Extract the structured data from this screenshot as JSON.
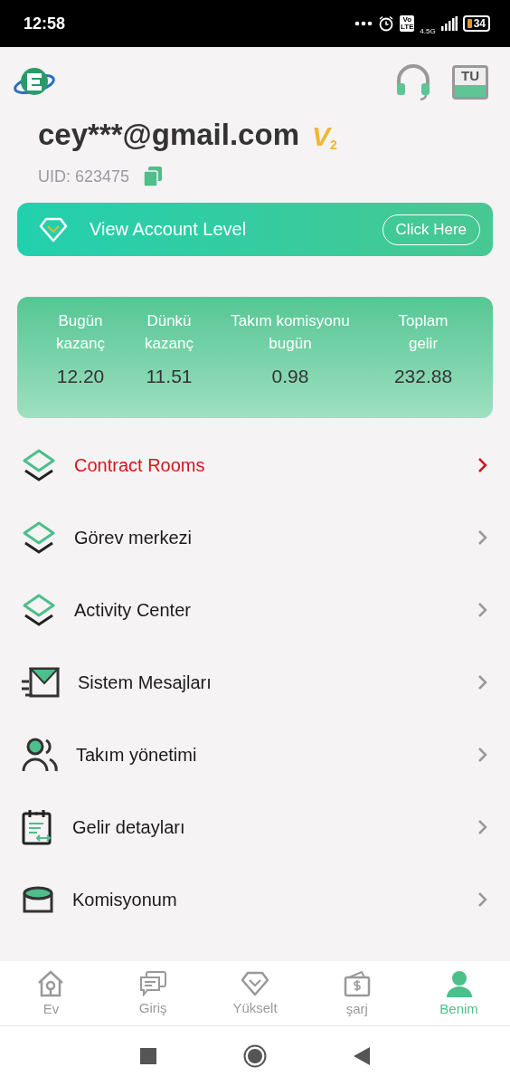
{
  "status_bar": {
    "time": "12:58",
    "network": "4.5G",
    "volte": "Vo LTE",
    "battery": "34"
  },
  "header": {
    "language": "TU"
  },
  "account": {
    "email": "cey***@gmail.com",
    "level_badge": "V",
    "level_number": "2",
    "uid": "UID: 623475"
  },
  "level_banner": {
    "label": "View Account Level",
    "button": "Click Here"
  },
  "stats": [
    {
      "label": "Bugün kazanç",
      "value": "12.20"
    },
    {
      "label": "Dünkü kazanç",
      "value": "11.51"
    },
    {
      "label": "Takım komisyonu bugün",
      "value": "0.98"
    },
    {
      "label": "Toplam gelir",
      "value": "232.88"
    }
  ],
  "menu": [
    {
      "kind": "layers",
      "label": "Contract Rooms",
      "selected": true
    },
    {
      "kind": "layers",
      "label": "Görev merkezi",
      "selected": false
    },
    {
      "kind": "layers",
      "label": "Activity Center",
      "selected": false
    },
    {
      "kind": "mail",
      "label": "Sistem Mesajları",
      "selected": false
    },
    {
      "kind": "users",
      "label": "Takım yönetimi",
      "selected": false
    },
    {
      "kind": "clipboard",
      "label": "Gelir detayları",
      "selected": false
    },
    {
      "kind": "database",
      "label": "Komisyonum",
      "selected": false
    }
  ],
  "tabs": [
    {
      "kind": "home",
      "label": "Ev",
      "selected": false
    },
    {
      "kind": "chat",
      "label": "Giriş",
      "selected": false
    },
    {
      "kind": "diamond",
      "label": "Yükselt",
      "selected": false
    },
    {
      "kind": "wallet",
      "label": "şarj",
      "selected": false
    },
    {
      "kind": "person",
      "label": "Benim",
      "selected": true
    }
  ]
}
